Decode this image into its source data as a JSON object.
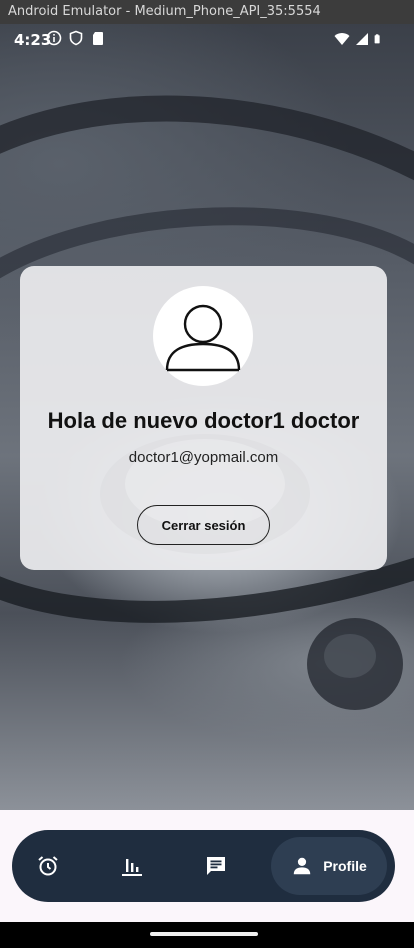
{
  "window": {
    "title": "Android Emulator - Medium_Phone_API_35:5554"
  },
  "status_bar": {
    "time": "4:23"
  },
  "profile_card": {
    "greeting": "Hola de nuevo doctor1 doctor",
    "email": "doctor1@yopmail.com",
    "logout_label": "Cerrar sesión"
  },
  "bottom_nav": {
    "items": [
      {
        "icon": "alarm-icon"
      },
      {
        "icon": "bar-chart-icon"
      },
      {
        "icon": "chat-icon"
      },
      {
        "icon": "person-icon",
        "label": "Profile",
        "selected": true
      }
    ]
  },
  "colors": {
    "nav_background": "#1f2d3f",
    "nav_selected": "#2e3e52",
    "card_background": "#f0f0f2"
  }
}
